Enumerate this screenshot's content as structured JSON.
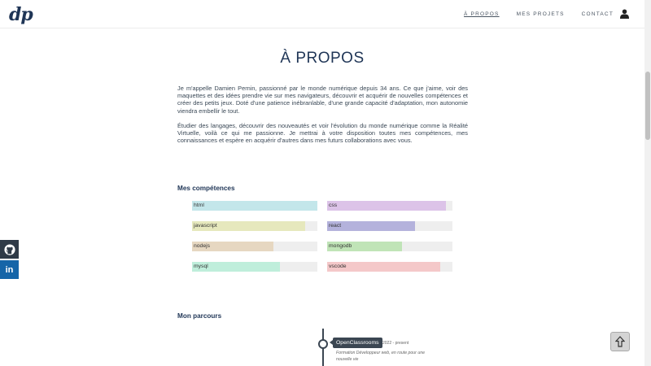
{
  "header": {
    "logo": "dp",
    "nav": [
      {
        "label": "À PROPOS",
        "active": true
      },
      {
        "label": "MES PROJETS",
        "active": false
      },
      {
        "label": "CONTACT",
        "active": false
      }
    ],
    "user_icon": "user-icon"
  },
  "about": {
    "title": "À PROPOS",
    "paragraphs": [
      "Je m'appelle Damien Pernin, passionné par le monde numérique depuis 34 ans. Ce que j'aime, voir des maquettes et des idées prendre vie sur mes navigateurs, découvrir et acquérir de nouvelles compétences et créer des petits jeux. Doté d'une patience inébranlable, d'une grande capacité d'adaptation, mon autonomie viendra embellir le tout.",
      "Étudier des langages, découvrir des nouveautés et voir l'évolution du monde numérique comme la Réalité Virtuelle, voilà ce qui me passionne. Je mettrai à votre disposition toutes mes compétences, mes connaissances et espère en acquérir d'autres dans mes futurs collaborations avec vous."
    ]
  },
  "skills": {
    "heading": "Mes compétences",
    "items": [
      {
        "name": "html",
        "level": 100,
        "color": "#c3e6ea"
      },
      {
        "name": "css",
        "level": 95,
        "color": "#dcc3e8"
      },
      {
        "name": "javascript",
        "level": 90,
        "color": "#e6e8bd"
      },
      {
        "name": "react",
        "level": 70,
        "color": "#b4b2dc"
      },
      {
        "name": "nodejs",
        "level": 65,
        "color": "#e6d7c1"
      },
      {
        "name": "mongodb",
        "level": 60,
        "color": "#c0e4b7"
      },
      {
        "name": "mysql",
        "level": 70,
        "color": "#bfeedb"
      },
      {
        "name": "vscode",
        "level": 90,
        "color": "#f4c8c9"
      }
    ]
  },
  "parcours": {
    "heading": "Mon parcours",
    "entries": [
      {
        "title": "OpenClassrooms",
        "date": "2022 - present",
        "description": "Formation Développeur web, en route pour une nouvelle vie"
      }
    ]
  },
  "social": {
    "github": "github-icon",
    "linkedin": "in"
  },
  "scroll_top_icon": "arrow-up-icon"
}
